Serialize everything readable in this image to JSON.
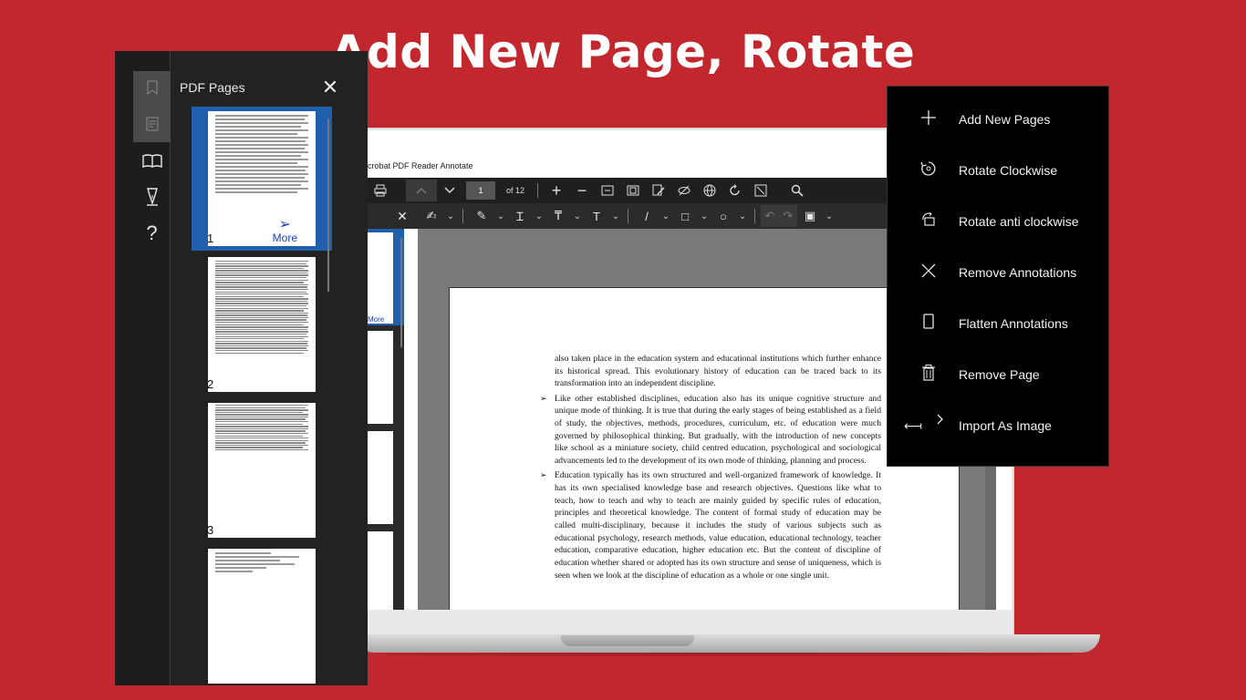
{
  "headline": "Add New Page, Rotate",
  "app": {
    "title": "crobat PDF Reader Annotate",
    "page_number": "1",
    "page_of": "of 12",
    "toolbar1_icons": [
      "print-icon",
      "page-up-icon",
      "page-down-icon",
      "zoom-in-icon",
      "zoom-out-icon",
      "fit-width-icon",
      "fit-page-icon",
      "edit-icon",
      "hide-annotations-icon",
      "globe-icon",
      "rotate-icon",
      "fullscreen-icon",
      "search-icon"
    ],
    "thumb_more": "More"
  },
  "document": {
    "paragraphs": [
      {
        "bullet": false,
        "text": "also taken place in the education system and educational institutions which further enhance its historical spread.  This evolutionary history of education can be traced back to its transformation into an independent discipline."
      },
      {
        "bullet": true,
        "text": "Like other established disciplines, education also has its unique cognitive structure and unique mode of thinking.  It is true that during the early stages of being established as a field of study, the objectives, methods, procedures, curriculum, etc. of education were much governed by philosophical thinking.  But gradually, with the introduction of new concepts like school as a miniature society, child centred education, psychological and sociological advancements led to the development of its own mode of thinking, planning and process."
      },
      {
        "bullet": true,
        "text": "Education typically has its own structured and well-organized framework of knowledge.  It has its own specialised knowledge base and research objectives. Questions like what to teach, how to teach and why to teach are mainly guided by specific rules of education, principles and theoretical knowledge.  The content of formal study of education may be called multi-disciplinary, because it includes the study of various subjects such as educational psychology, research methods, value education, educational technology, teacher education, comparative education, higher education etc.  But the content of discipline of education whether shared or adopted has its own structure and sense of uniqueness, which is seen when we look at the discipline of education as a whole or one single unit."
      }
    ]
  },
  "panel": {
    "title": "PDF Pages",
    "close_icon": "✕",
    "thumbnails": [
      {
        "number": "1",
        "more_label": "More"
      },
      {
        "number": "2"
      },
      {
        "number": "3"
      },
      {
        "number": ""
      }
    ]
  },
  "menu": {
    "items": [
      {
        "label": "Add New Pages",
        "icon": "plus-icon"
      },
      {
        "label": "Rotate Clockwise",
        "icon": "rotate-clockwise-icon"
      },
      {
        "label": "Rotate anti clockwise",
        "icon": "rotate-anticlockwise-icon"
      },
      {
        "label": "Remove Annotations",
        "icon": "close-icon"
      },
      {
        "label": "Flatten Annotations",
        "icon": "page-icon"
      },
      {
        "label": "Remove Page",
        "icon": "trash-icon"
      },
      {
        "label": "Import As Image",
        "icon": "chevron-right-icon"
      }
    ]
  },
  "colors": {
    "background": "#c1272d",
    "selection": "#1f5fae",
    "menu_bg": "#000000",
    "panel_bg": "#222222"
  }
}
